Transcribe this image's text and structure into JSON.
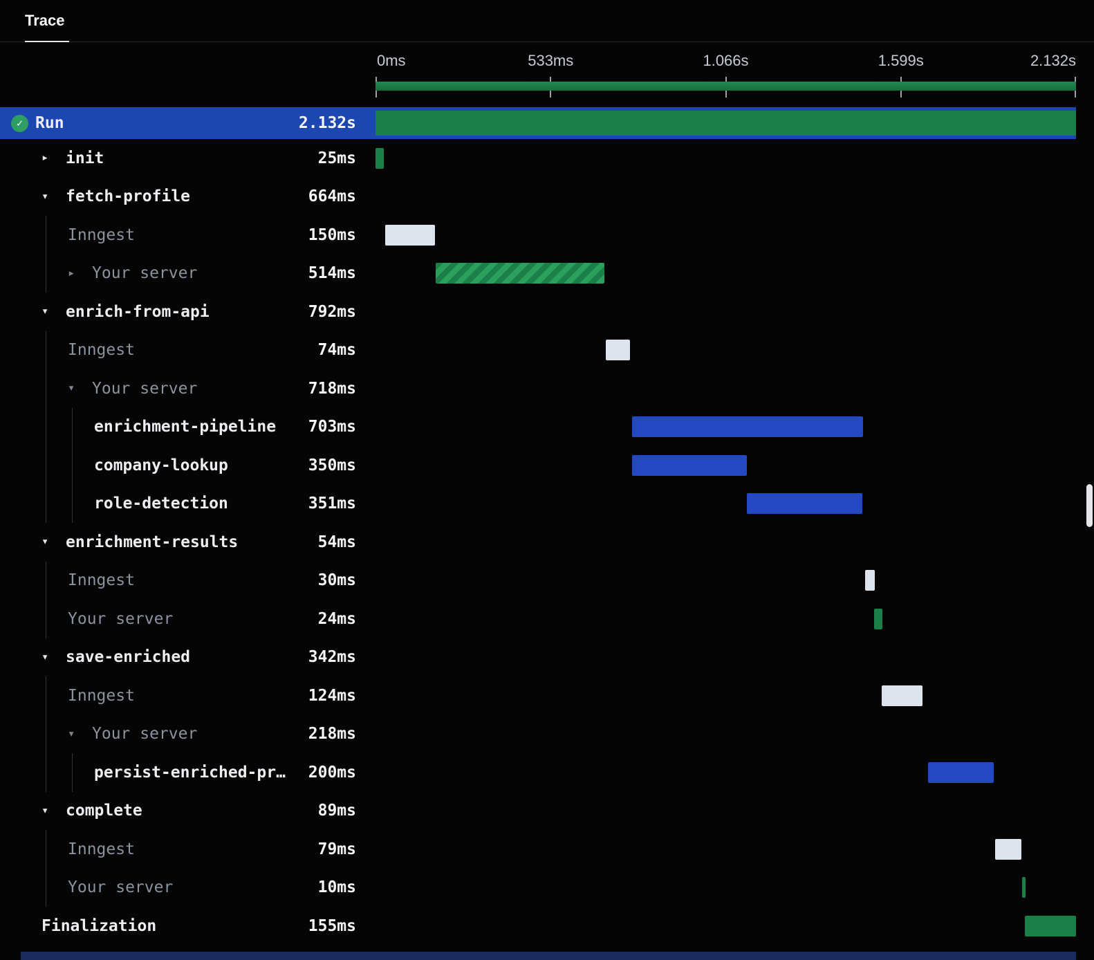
{
  "header": {
    "tab_label": "Trace"
  },
  "timeline": {
    "ticks": [
      "0ms",
      "533ms",
      "1.066s",
      "1.599s",
      "2.132s"
    ],
    "total_ms": 2132
  },
  "colors": {
    "bg": "#050505",
    "selected-row": "#1c46b0",
    "bar-green": "#1b7f49",
    "bar-green-light": "#2ba05d",
    "bar-blue": "#2447c2",
    "bar-light": "#dde4ee",
    "text": "#eceef1",
    "text-muted": "#8b939e",
    "guide": "#30343a",
    "tick": "#c6cbd2"
  },
  "chart_data": {
    "type": "table",
    "title": "Trace waterfall",
    "x_axis_ticks": [
      "0ms",
      "533ms",
      "1.066s",
      "1.599s",
      "2.132s"
    ],
    "total_duration_ms": 2132
  },
  "rows": [
    {
      "name": "Run",
      "duration": "2.132s",
      "level": 0,
      "icon": "check",
      "selected": true,
      "bar": {
        "start": 0,
        "dur": 2132,
        "kind": "green"
      }
    },
    {
      "name": "init",
      "duration": "25ms",
      "level": 1,
      "caret": "collapsed",
      "bar": {
        "start": 0,
        "dur": 25,
        "kind": "green"
      }
    },
    {
      "name": "fetch-profile",
      "duration": "664ms",
      "level": 1,
      "caret": "expanded"
    },
    {
      "name": "Inngest",
      "duration": "150ms",
      "level": 2,
      "muted": true,
      "bar": {
        "start": 30,
        "dur": 150,
        "kind": "light"
      }
    },
    {
      "name": "Your server",
      "duration": "514ms",
      "level": 2,
      "muted": true,
      "caret": "collapsed",
      "bar": {
        "start": 183,
        "dur": 514,
        "kind": "hatch"
      }
    },
    {
      "name": "enrich-from-api",
      "duration": "792ms",
      "level": 1,
      "caret": "expanded"
    },
    {
      "name": "Inngest",
      "duration": "74ms",
      "level": 2,
      "muted": true,
      "bar": {
        "start": 700,
        "dur": 74,
        "kind": "light"
      }
    },
    {
      "name": "Your server",
      "duration": "718ms",
      "level": 2,
      "muted": true,
      "caret": "expanded"
    },
    {
      "name": "enrichment-pipeline",
      "duration": "703ms",
      "level": 3,
      "bar": {
        "start": 781,
        "dur": 703,
        "kind": "blue"
      }
    },
    {
      "name": "company-lookup",
      "duration": "350ms",
      "level": 3,
      "bar": {
        "start": 781,
        "dur": 350,
        "kind": "blue"
      }
    },
    {
      "name": "role-detection",
      "duration": "351ms",
      "level": 3,
      "bar": {
        "start": 1131,
        "dur": 351,
        "kind": "blue"
      }
    },
    {
      "name": "enrichment-results",
      "duration": "54ms",
      "level": 1,
      "caret": "expanded"
    },
    {
      "name": "Inngest",
      "duration": "30ms",
      "level": 2,
      "muted": true,
      "bar": {
        "start": 1490,
        "dur": 30,
        "kind": "light"
      }
    },
    {
      "name": "Your server",
      "duration": "24ms",
      "level": 2,
      "muted": true,
      "bar": {
        "start": 1518,
        "dur": 24,
        "kind": "green"
      }
    },
    {
      "name": "save-enriched",
      "duration": "342ms",
      "level": 1,
      "caret": "expanded"
    },
    {
      "name": "Inngest",
      "duration": "124ms",
      "level": 2,
      "muted": true,
      "bar": {
        "start": 1540,
        "dur": 124,
        "kind": "light"
      }
    },
    {
      "name": "Your server",
      "duration": "218ms",
      "level": 2,
      "muted": true,
      "caret": "expanded"
    },
    {
      "name": "persist-enriched-pr…",
      "duration": "200ms",
      "level": 3,
      "bar": {
        "start": 1682,
        "dur": 200,
        "kind": "blue"
      }
    },
    {
      "name": "complete",
      "duration": "89ms",
      "level": 1,
      "caret": "expanded"
    },
    {
      "name": "Inngest",
      "duration": "79ms",
      "level": 2,
      "muted": true,
      "bar": {
        "start": 1886,
        "dur": 79,
        "kind": "light"
      }
    },
    {
      "name": "Your server",
      "duration": "10ms",
      "level": 2,
      "muted": true,
      "bar": {
        "start": 1968,
        "dur": 10,
        "kind": "green"
      }
    },
    {
      "name": "Finalization",
      "duration": "155ms",
      "level": 1,
      "bar": {
        "start": 1977,
        "dur": 155,
        "kind": "green"
      }
    }
  ],
  "icons": {
    "run_status": "check",
    "caret_expanded": "▾",
    "caret_collapsed": "▸",
    "check_glyph": "✓"
  }
}
